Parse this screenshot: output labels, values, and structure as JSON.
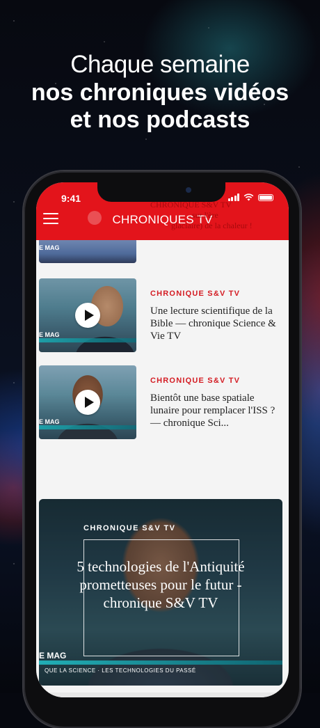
{
  "promo": {
    "line1": "Chaque semaine",
    "line2": "nos chroniques vidéos",
    "line3": "et nos podcasts"
  },
  "status_bar": {
    "time": "9:41"
  },
  "app_bar": {
    "title": "CHRONIQUES TV"
  },
  "ghost_header": {
    "line1": "CHRONIQUE S&V TV",
    "line2": "sur l'ère",
    "line3": "glaciaire) de la chaleur !"
  },
  "articles": [
    {
      "category": "CHRONIQUE S&V TV",
      "title": "Une lecture scientifique de la Bible — chronique Science & Vie TV",
      "thumb_label": "E MAG"
    },
    {
      "category": "CHRONIQUE S&V TV",
      "title": "Bientôt une base spatiale lunaire pour remplacer l'ISS ? — chronique Sci...",
      "thumb_label": "E MAG"
    }
  ],
  "partial_thumb_label": "E MAG",
  "featured": {
    "category": "CHRONIQUE S&V TV",
    "title": "5 technologies de l'Antiquité prometteuses pour le futur - chronique S&V TV",
    "thumb_label": "E MAG",
    "thumb_subtitle": "QUE LA SCIENCE · LES TECHNOLOGIES DU PASSÉ"
  },
  "colors": {
    "brand_red": "#e3141b",
    "category_red": "#d41c23",
    "lower_third_teal": "#18b1b8"
  },
  "icons": [
    "hamburger-menu-icon",
    "signal-icon",
    "wifi-icon",
    "battery-icon",
    "play-icon"
  ]
}
